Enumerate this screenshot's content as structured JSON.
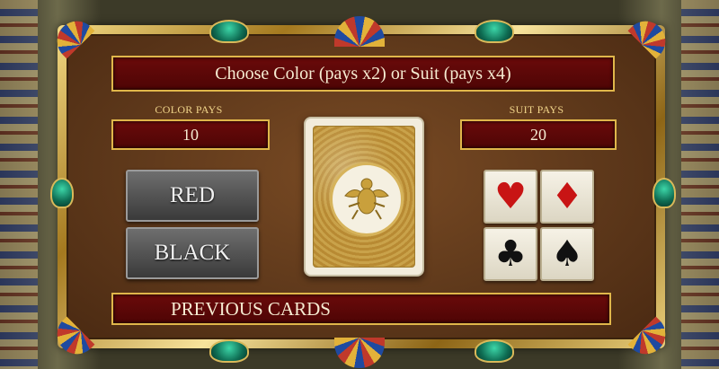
{
  "header": {
    "title": "Choose Color (pays x2) or Suit (pays x4)"
  },
  "color_pays": {
    "label": "COLOR PAYS",
    "value": "10"
  },
  "suit_pays": {
    "label": "SUIT PAYS",
    "value": "20"
  },
  "buttons": {
    "red": "RED",
    "black": "BLACK"
  },
  "suits": [
    {
      "name": "hearts",
      "glyph": "♥",
      "color": "#c81414"
    },
    {
      "name": "diamonds",
      "glyph": "♦",
      "color": "#c81414"
    },
    {
      "name": "clubs",
      "glyph": "♣",
      "color": "#111111"
    },
    {
      "name": "spades",
      "glyph": "♠",
      "color": "#111111"
    }
  ],
  "card": {
    "icon": "scarab-icon"
  },
  "footer": {
    "previous_cards": "PREVIOUS CARDS"
  },
  "colors": {
    "accent_gold": "#e0b64a",
    "bar_red": "#5a0707",
    "felt": "#6a4120"
  }
}
